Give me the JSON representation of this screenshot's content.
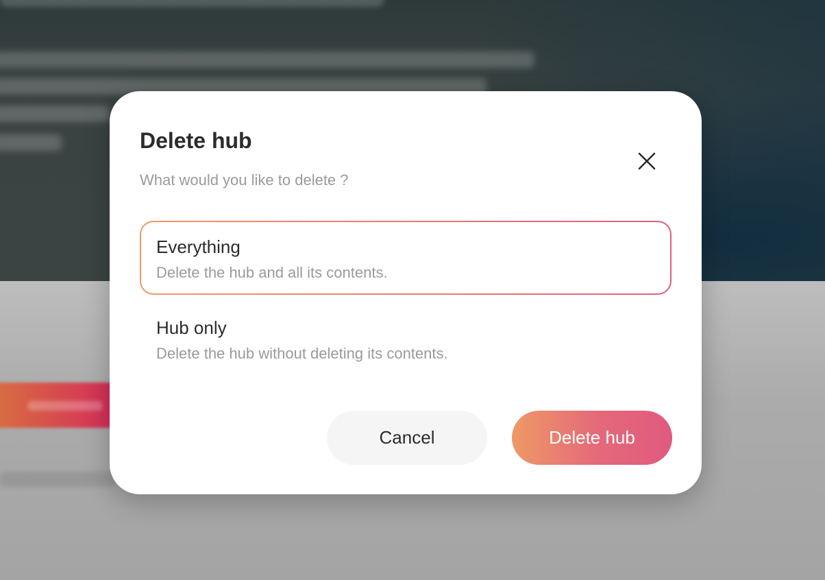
{
  "modal": {
    "title": "Delete hub",
    "subtitle": "What would you like to delete ?",
    "close_icon": "close-icon",
    "options": [
      {
        "title": "Everything",
        "description": "Delete the hub and all its contents.",
        "selected": true
      },
      {
        "title": "Hub only",
        "description": "Delete the hub without deleting its contents.",
        "selected": false
      }
    ],
    "cancel_label": "Cancel",
    "confirm_label": "Delete hub"
  },
  "colors": {
    "accent_start": "#ee9966",
    "accent_end": "#e05a7e",
    "text_primary": "#2b2b2b",
    "text_secondary": "#9a9a9a"
  }
}
